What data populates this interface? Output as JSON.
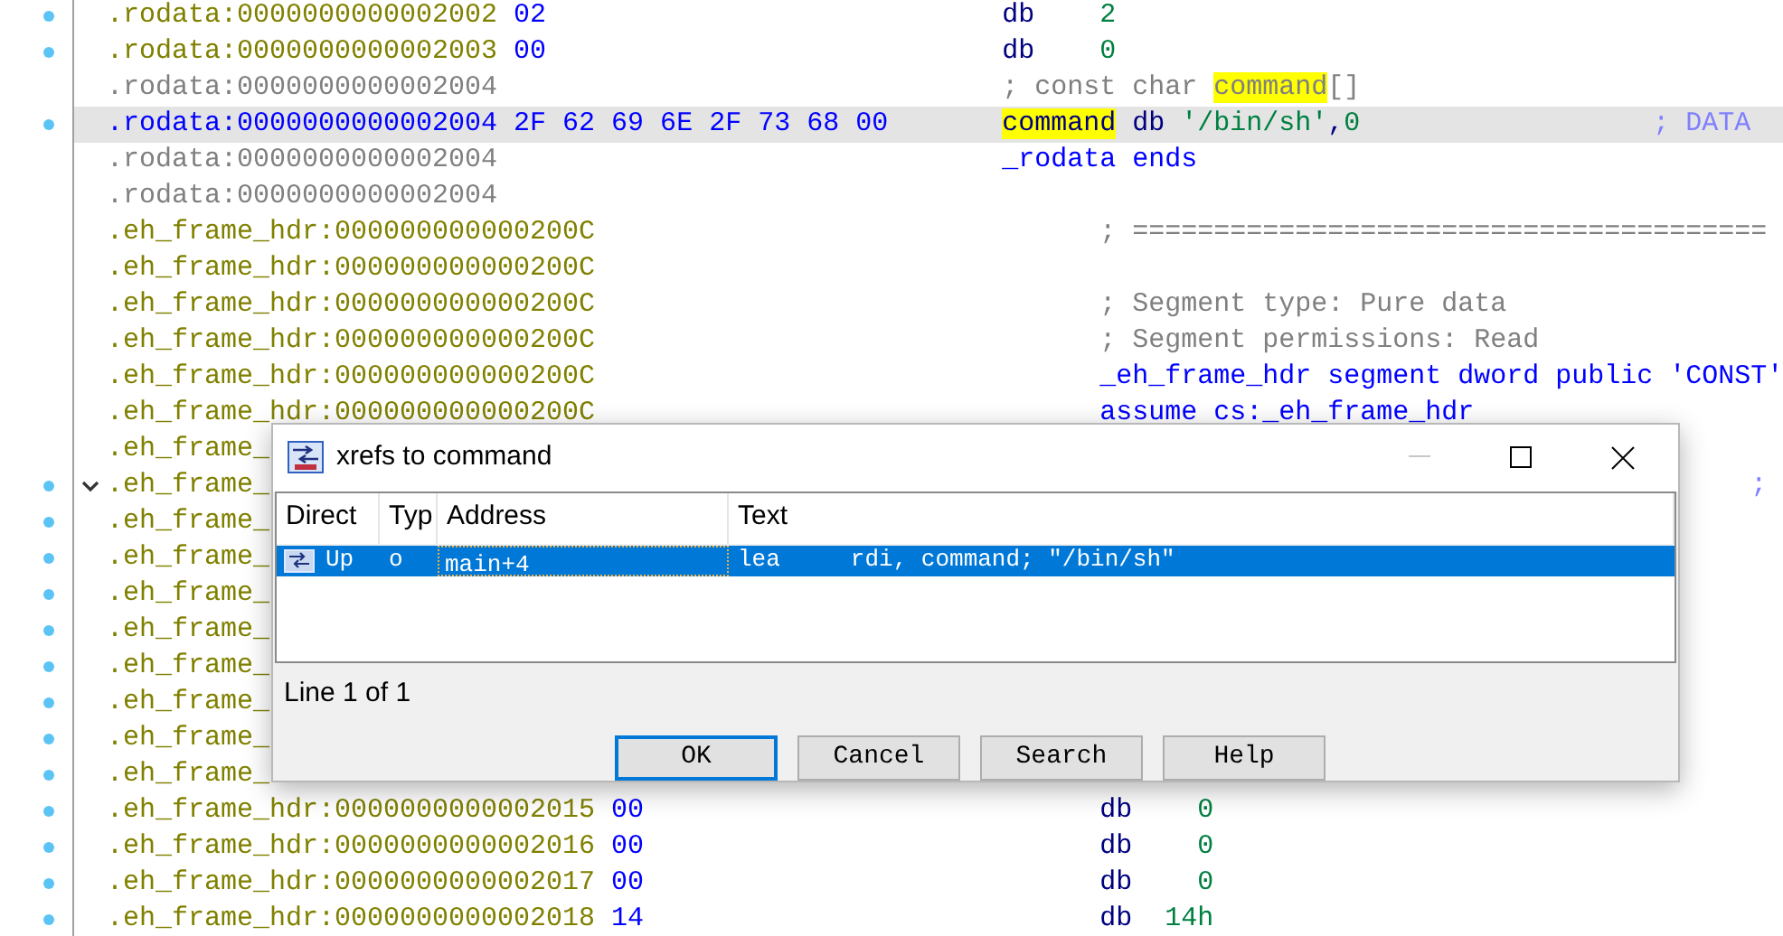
{
  "listing": [
    {
      "address": ".rodata:0000000000002002",
      "bytes": "02",
      "kind": "data",
      "selected": false,
      "marked": true,
      "tokens": [
        {
          "t": "db",
          "kind": "op"
        },
        {
          "t": "    2",
          "kind": "num"
        }
      ]
    },
    {
      "address": ".rodata:0000000000002003",
      "bytes": "00",
      "kind": "data",
      "selected": false,
      "marked": true,
      "tokens": [
        {
          "t": "db",
          "kind": "op"
        },
        {
          "t": "    0",
          "kind": "num"
        }
      ]
    },
    {
      "address": ".rodata:0000000000002004",
      "kind": "continuation",
      "selected": false,
      "marked": false,
      "tokens": [
        {
          "t": "; const char ",
          "kind": "comment"
        },
        {
          "t": "command",
          "kind": "comment",
          "highlighted": true
        },
        {
          "t": "[]",
          "kind": "comment"
        }
      ]
    },
    {
      "address": ".rodata:0000000000002004",
      "bytes": "2F 62 69 6E 2F 73 68 00",
      "kind": "data",
      "selected": true,
      "marked": true,
      "tokens": [
        {
          "t": "command",
          "kind": "op",
          "highlighted": true
        },
        {
          "t": " db ",
          "kind": "op"
        },
        {
          "t": "'/bin/sh'",
          "kind": "str"
        },
        {
          "t": ",",
          "kind": "op"
        },
        {
          "t": "0",
          "kind": "num"
        }
      ],
      "comment": "; DATA"
    },
    {
      "address": ".rodata:0000000000002004",
      "kind": "continuation",
      "selected": false,
      "marked": false,
      "tokens": [
        {
          "t": "_rodata ends",
          "kind": "kw"
        }
      ]
    },
    {
      "address": ".rodata:0000000000002004",
      "kind": "continuation",
      "selected": false,
      "marked": false
    },
    {
      "address": ".eh_frame_hdr:000000000000200C",
      "kind": "data",
      "selected": false,
      "marked": false,
      "tokens": [
        {
          "t": "; =======================================",
          "kind": "comment"
        }
      ]
    },
    {
      "address": ".eh_frame_hdr:000000000000200C",
      "kind": "data",
      "selected": false,
      "marked": false
    },
    {
      "address": ".eh_frame_hdr:000000000000200C",
      "kind": "data",
      "selected": false,
      "marked": false,
      "tokens": [
        {
          "t": "; Segment type: Pure data",
          "kind": "comment"
        }
      ]
    },
    {
      "address": ".eh_frame_hdr:000000000000200C",
      "kind": "data",
      "selected": false,
      "marked": false,
      "tokens": [
        {
          "t": "; Segment permissions: Read",
          "kind": "comment"
        }
      ]
    },
    {
      "address": ".eh_frame_hdr:000000000000200C",
      "kind": "data",
      "selected": false,
      "marked": false,
      "tokens": [
        {
          "t": "_eh_frame_hdr segment dword public 'CONST'",
          "kind": "kw"
        }
      ]
    },
    {
      "address": ".eh_frame_hdr:000000000000200C",
      "kind": "data",
      "selected": false,
      "marked": false,
      "tokens": [
        {
          "t": "assume cs:_eh_frame_hdr",
          "kind": "kw"
        }
      ]
    },
    {
      "address": ".eh_frame_",
      "kind": "covered",
      "selected": false,
      "marked": false
    },
    {
      "address": ".eh_frame_",
      "kind": "covered",
      "selected": false,
      "marked": true,
      "expanded": true,
      "comment": ";"
    },
    {
      "address": ".eh_frame_",
      "kind": "covered",
      "selected": false,
      "marked": true
    },
    {
      "address": ".eh_frame_",
      "kind": "covered",
      "selected": false,
      "marked": true
    },
    {
      "address": ".eh_frame_",
      "kind": "covered",
      "selected": false,
      "marked": true
    },
    {
      "address": ".eh_frame_",
      "kind": "covered",
      "selected": false,
      "marked": true
    },
    {
      "address": ".eh_frame_",
      "kind": "covered",
      "selected": false,
      "marked": true
    },
    {
      "address": ".eh_frame_",
      "kind": "covered",
      "selected": false,
      "marked": true
    },
    {
      "address": ".eh_frame_",
      "kind": "covered",
      "selected": false,
      "marked": true
    },
    {
      "address": ".eh_frame_",
      "kind": "covered",
      "selected": false,
      "marked": true
    },
    {
      "address": ".eh_frame_hdr:0000000000002015",
      "bytes": "00",
      "kind": "data",
      "selected": false,
      "marked": true,
      "tokens": [
        {
          "t": "db",
          "kind": "op"
        },
        {
          "t": "    0",
          "kind": "num"
        }
      ]
    },
    {
      "address": ".eh_frame_hdr:0000000000002016",
      "bytes": "00",
      "kind": "data",
      "selected": false,
      "marked": true,
      "tokens": [
        {
          "t": "db",
          "kind": "op"
        },
        {
          "t": "    0",
          "kind": "num"
        }
      ]
    },
    {
      "address": ".eh_frame_hdr:0000000000002017",
      "bytes": "00",
      "kind": "data",
      "selected": false,
      "marked": true,
      "tokens": [
        {
          "t": "db",
          "kind": "op"
        },
        {
          "t": "    0",
          "kind": "num"
        }
      ]
    },
    {
      "address": ".eh_frame_hdr:0000000000002018",
      "bytes": "14",
      "kind": "data",
      "selected": false,
      "marked": true,
      "tokens": [
        {
          "t": "db",
          "kind": "op"
        },
        {
          "t": "  14h",
          "kind": "num"
        }
      ]
    }
  ],
  "dialog": {
    "title": "xrefs to command",
    "columns": [
      "Direct",
      "Typ",
      "Address",
      "Text"
    ],
    "rows": [
      {
        "direction": "Up",
        "type": "o",
        "address": "main+4",
        "text": "lea     rdi, command; \"/bin/sh\"",
        "selected": true
      }
    ],
    "status": "Line 1 of 1",
    "buttons": [
      {
        "label": "OK",
        "selected": true
      },
      {
        "label": "Cancel",
        "selected": false
      },
      {
        "label": "Search",
        "selected": false
      },
      {
        "label": "Help",
        "selected": false
      }
    ]
  }
}
